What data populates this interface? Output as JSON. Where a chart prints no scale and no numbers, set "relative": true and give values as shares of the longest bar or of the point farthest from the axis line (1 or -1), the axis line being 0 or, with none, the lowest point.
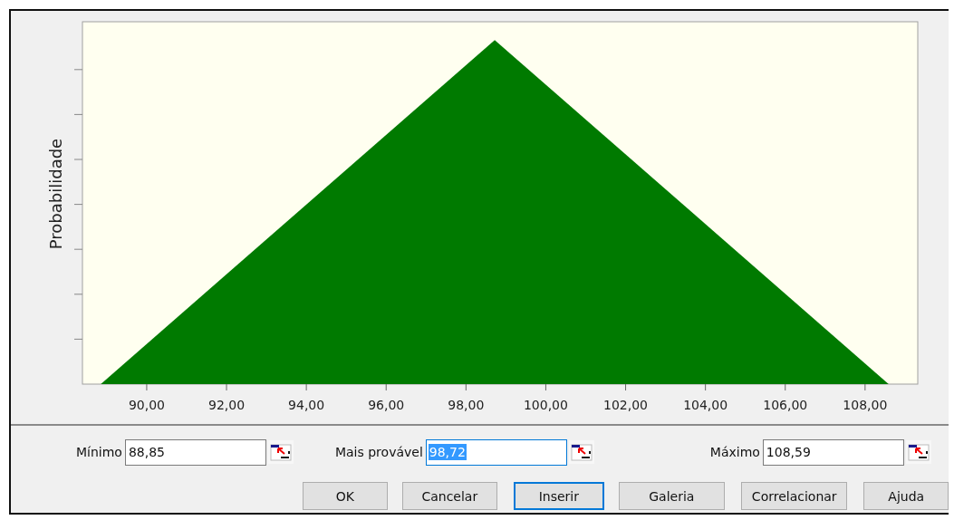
{
  "chart": {
    "chart_data": {
      "type": "area",
      "ylabel": "Probabilidade",
      "x": [
        88.85,
        98.72,
        108.59
      ],
      "values": [
        0,
        1,
        0
      ],
      "relative": true,
      "xlim": [
        88.39,
        109.32
      ],
      "xticks": [
        {
          "value": 90,
          "label": "90,00"
        },
        {
          "value": 92,
          "label": "92,00"
        },
        {
          "value": 94,
          "label": "94,00"
        },
        {
          "value": 96,
          "label": "96,00"
        },
        {
          "value": 98,
          "label": "98,00"
        },
        {
          "value": 100,
          "label": "100,00"
        },
        {
          "value": 102,
          "label": "102,00"
        },
        {
          "value": 104,
          "label": "104,00"
        },
        {
          "value": 106,
          "label": "106,00"
        },
        {
          "value": 108,
          "label": "108,00"
        }
      ],
      "color": "#007a00"
    }
  },
  "fields": [
    {
      "label": "Mínimo",
      "value": "88,85",
      "focused": false
    },
    {
      "label": "Mais provável",
      "value": "98,72",
      "focused": true
    },
    {
      "label": "Máximo",
      "value": "108,59",
      "focused": false
    }
  ],
  "buttons": [
    {
      "label": "OK",
      "focused": false
    },
    {
      "label": "Cancelar",
      "focused": false
    },
    {
      "label": "Inserir",
      "focused": true
    },
    {
      "label": "Galeria",
      "focused": false
    },
    {
      "label": "Correlacionar",
      "focused": false
    },
    {
      "label": "Ajuda",
      "focused": false
    }
  ]
}
